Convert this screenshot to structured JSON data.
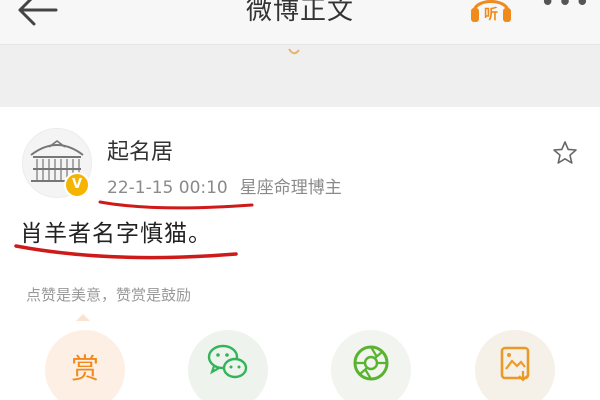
{
  "header": {
    "title": "微博正文",
    "listen_label": "听"
  },
  "post": {
    "author": "起名居",
    "badge": "V",
    "timestamp": "22-1-15 00:10",
    "source": "星座命理博主",
    "content": "肖羊者名字慎猫。"
  },
  "reward": {
    "hint": "点赞是美意，赞赏是鼓励",
    "button_label": "赏"
  },
  "colors": {
    "accent": "#f08a1c",
    "badge": "#f5b400",
    "underline": "#cf1a1a",
    "wechat": "#34b45a"
  },
  "icons": [
    "back-arrow-icon",
    "listen-icon",
    "more-icon",
    "star-icon",
    "wechat-icon",
    "moments-icon",
    "save-image-icon"
  ]
}
